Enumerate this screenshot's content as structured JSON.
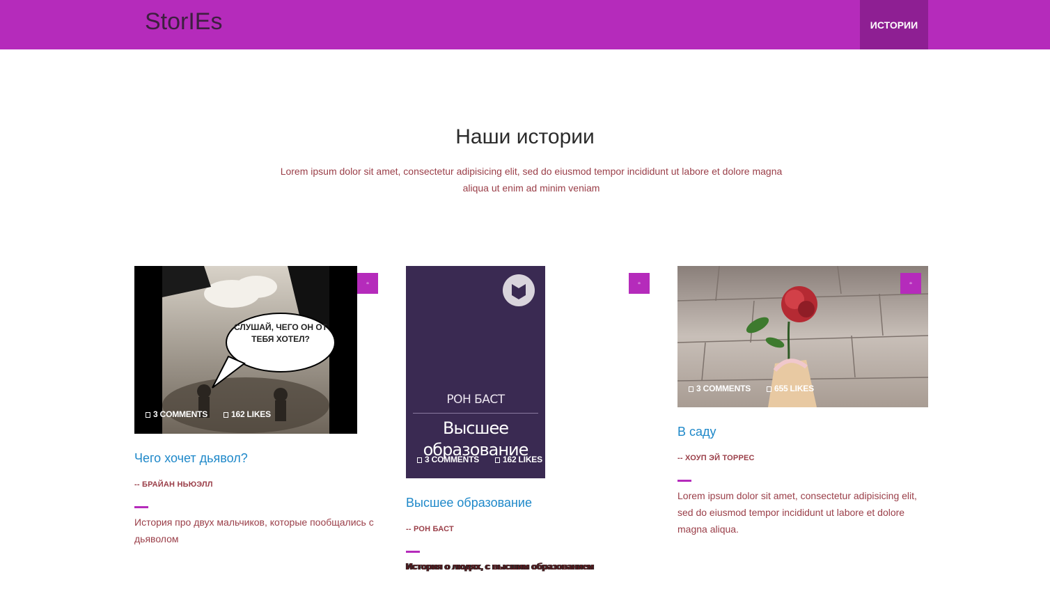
{
  "header": {
    "brand": "StorIEs",
    "nav": [
      "ИСТОРИИ"
    ]
  },
  "intro": {
    "title": "Наши истории",
    "subtitle": "Lorem ipsum dolor sit amet, consectetur adipisicing elit, sed do eiusmod tempor incididunt ut labore et dolore magna aliqua ut enim ad minim veniam"
  },
  "cards": [
    {
      "comments": "3 COMMENTS",
      "likes": "162 LIKES",
      "image_text": "СЛУШАЙ, ЧЕГО ОН ОТ ТЕБЯ ХОТЕЛ?",
      "title": "Чего хочет дьявол?",
      "author": "-- БРАЙАН НЬЮЭЛЛ",
      "text": "История про двух мальчиков, которые пообщались с дьяволом"
    },
    {
      "comments": "3 COMMENTS",
      "likes": "162 LIKES",
      "cover_author": "РОН БАСТ",
      "cover_title": "Высшее образование",
      "title": "Высшее образование",
      "author": "-- РОН БАСТ",
      "text": "История о людях, с высшим образованием"
    },
    {
      "comments": "3 COMMENTS",
      "likes": "655 LIKES",
      "title": "В саду",
      "author": "-- ХОУП ЭЙ ТОРРЕС",
      "text": "Lorem ipsum dolor sit amet, consectetur adipisicing elit, sed do eiusmod tempor incididunt ut labore et dolore magna aliqua."
    }
  ],
  "colors": {
    "accent": "#b52bbb",
    "accent_dark": "#8e1f93",
    "link": "#1e88c9",
    "text": "#9a3e48"
  }
}
